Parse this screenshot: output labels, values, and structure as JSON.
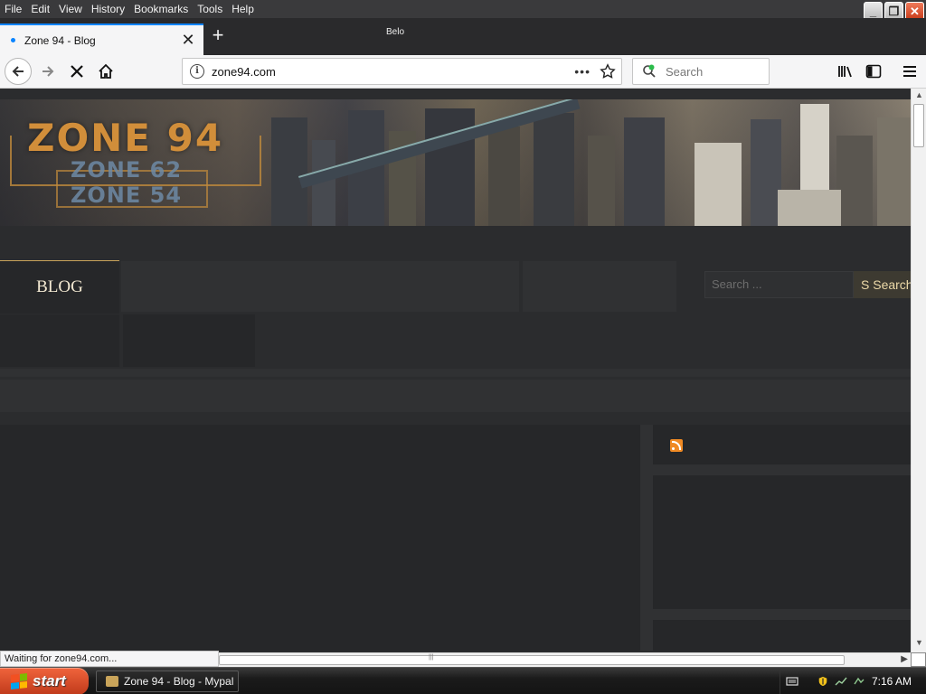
{
  "menu": [
    "File",
    "Edit",
    "View",
    "History",
    "Bookmarks",
    "Tools",
    "Help"
  ],
  "window_buttons": {
    "minimize": "_",
    "restore": "❐",
    "close": "✕"
  },
  "tab": {
    "title": "Zone 94 - Blog",
    "close_glyph": "✕"
  },
  "new_tab_glyph": "+",
  "drag_ghost": "Belo",
  "nav": {
    "url": "zone94.com",
    "search_placeholder": "Search",
    "page_actions": "•••"
  },
  "banner": {
    "logo_main": "ZONE 94",
    "logo_sub1": "ZONE 62",
    "logo_sub2": "ZONE 54"
  },
  "site_nav": {
    "blog_label": "BLOG"
  },
  "site_search": {
    "placeholder": "Search ...",
    "button_label": "S  Search"
  },
  "status_text": "Waiting for zone94.com...",
  "taskbar": {
    "start_label": "start",
    "task_title": "Zone 94 - Blog - Mypal",
    "clock": "7:16 AM"
  },
  "colors": {
    "accent": "#0a84ff",
    "gold": "#c9a45a",
    "page_bg": "#2b2c2e",
    "rss": "#f08a24"
  }
}
